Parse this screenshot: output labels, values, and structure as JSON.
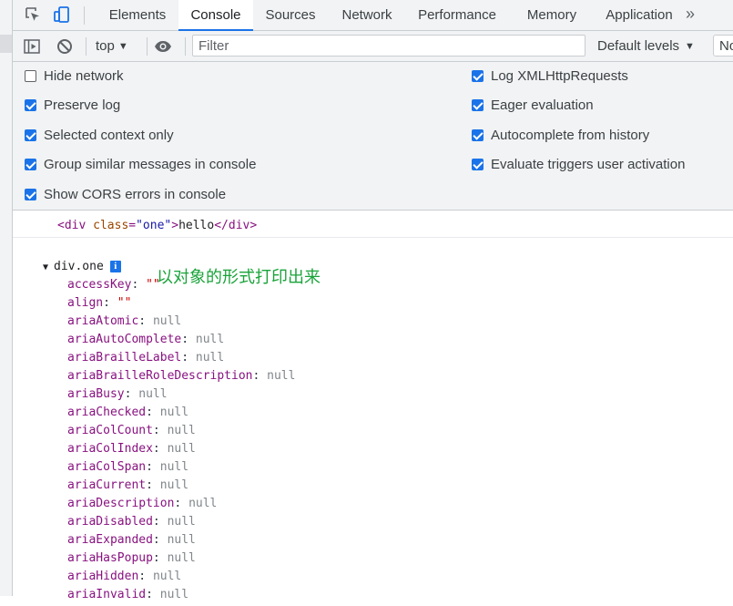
{
  "tabs": [
    {
      "label": "Elements",
      "active": false
    },
    {
      "label": "Console",
      "active": true
    },
    {
      "label": "Sources",
      "active": false
    },
    {
      "label": "Network",
      "active": false
    },
    {
      "label": "Performance",
      "active": false
    },
    {
      "label": "Memory",
      "active": false
    },
    {
      "label": "Application",
      "active": false
    }
  ],
  "more_tabs": "»",
  "toolbar": {
    "context": "top",
    "filter_placeholder": "Filter",
    "levels": "Default levels",
    "issues": "No Issues"
  },
  "settings": {
    "left": [
      {
        "label": "Hide network",
        "checked": false
      },
      {
        "label": "Preserve log",
        "checked": true
      },
      {
        "label": "Selected context only",
        "checked": true
      },
      {
        "label": "Group similar messages in console",
        "checked": true
      },
      {
        "label": "Show CORS errors in console",
        "checked": true
      }
    ],
    "right": [
      {
        "label": "Log XMLHttpRequests",
        "checked": true
      },
      {
        "label": "Eager evaluation",
        "checked": true
      },
      {
        "label": "Autocomplete from history",
        "checked": true
      },
      {
        "label": "Evaluate triggers user activation",
        "checked": true
      }
    ]
  },
  "console": {
    "html_log": {
      "tag": "div",
      "attr_name": "class",
      "attr_value": "\"one\"",
      "text": "hello"
    },
    "object_log": {
      "label": "div.one",
      "annotation": "以对象的形式打印出来",
      "properties": [
        {
          "key": "accessKey",
          "value": "\"\"",
          "kind": "string"
        },
        {
          "key": "align",
          "value": "\"\"",
          "kind": "string"
        },
        {
          "key": "ariaAtomic",
          "value": "null",
          "kind": "null"
        },
        {
          "key": "ariaAutoComplete",
          "value": "null",
          "kind": "null"
        },
        {
          "key": "ariaBrailleLabel",
          "value": "null",
          "kind": "null"
        },
        {
          "key": "ariaBrailleRoleDescription",
          "value": "null",
          "kind": "null"
        },
        {
          "key": "ariaBusy",
          "value": "null",
          "kind": "null"
        },
        {
          "key": "ariaChecked",
          "value": "null",
          "kind": "null"
        },
        {
          "key": "ariaColCount",
          "value": "null",
          "kind": "null"
        },
        {
          "key": "ariaColIndex",
          "value": "null",
          "kind": "null"
        },
        {
          "key": "ariaColSpan",
          "value": "null",
          "kind": "null"
        },
        {
          "key": "ariaCurrent",
          "value": "null",
          "kind": "null"
        },
        {
          "key": "ariaDescription",
          "value": "null",
          "kind": "null"
        },
        {
          "key": "ariaDisabled",
          "value": "null",
          "kind": "null"
        },
        {
          "key": "ariaExpanded",
          "value": "null",
          "kind": "null"
        },
        {
          "key": "ariaHasPopup",
          "value": "null",
          "kind": "null"
        },
        {
          "key": "ariaHidden",
          "value": "null",
          "kind": "null"
        },
        {
          "key": "ariaInvalid",
          "value": "null",
          "kind": "null"
        }
      ]
    }
  },
  "colors": {
    "accent": "#1a73e8",
    "panel_bg": "#f1f3f4",
    "tag": "#881280",
    "attr_name": "#994500",
    "attr_value": "#1a1aa6",
    "null_value": "#80868b",
    "string_value": "#c80000",
    "annotation": "#1aa33a"
  },
  "icons": [
    "inspect-element-icon",
    "device-toolbar-icon",
    "sidebar-toggle-icon",
    "clear-console-icon",
    "eye-icon",
    "info-icon",
    "expand-triangle-icon"
  ]
}
